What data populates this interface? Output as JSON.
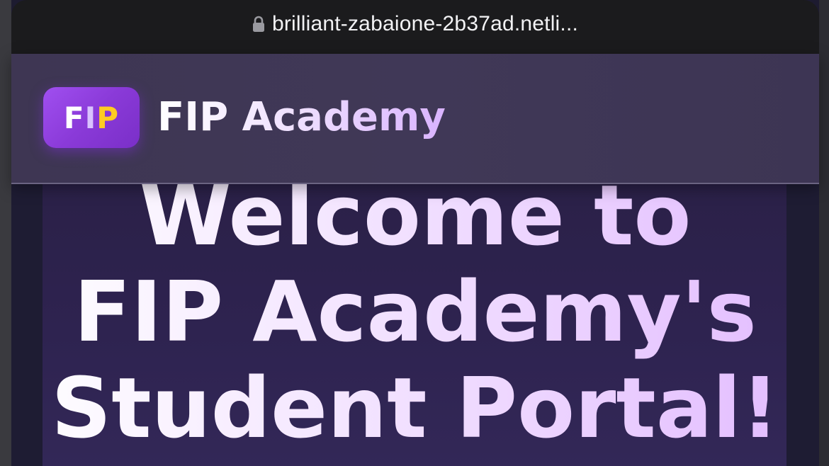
{
  "browser": {
    "url": "brilliant-zabaione-2b37ad.netli...",
    "lock_icon": "lock-icon"
  },
  "header": {
    "logo": {
      "letter_1": "F",
      "letter_2": "I",
      "letter_3": "P"
    },
    "brand_name": "FIP Academy"
  },
  "hero": {
    "line_1": "Welcome to",
    "line_2": "FIP Academy's",
    "line_3": "Student Portal!"
  },
  "colors": {
    "logo_gradient_start": "#a04ff0",
    "logo_gradient_end": "#7a2fc8",
    "logo_accent_yellow": "#ffcc22",
    "header_bg": "#403857",
    "page_bg": "#1e1c33",
    "title_gradient_end": "#e2bbff"
  }
}
